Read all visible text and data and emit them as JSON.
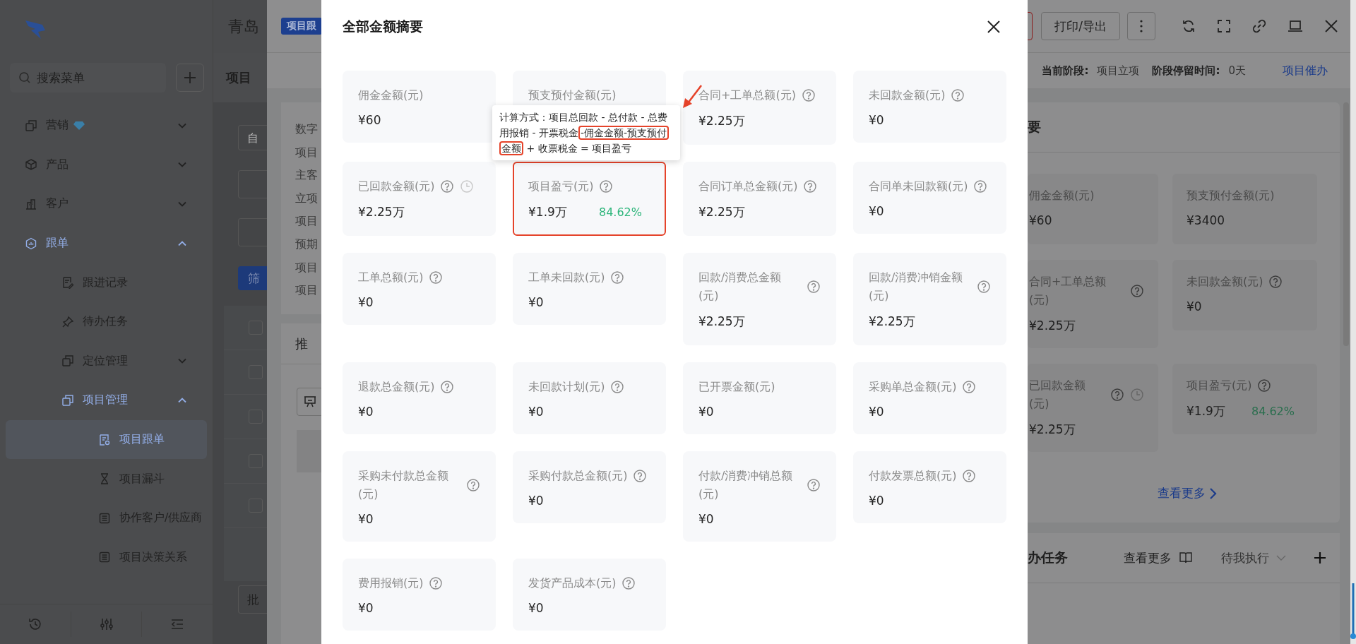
{
  "sidebar": {
    "search_placeholder": "搜索菜单",
    "items": [
      {
        "label": "营销",
        "premium": true,
        "expanded": false,
        "selected": false
      },
      {
        "label": "产品",
        "premium": false,
        "expanded": false,
        "selected": false
      },
      {
        "label": "客户",
        "premium": false,
        "expanded": false,
        "selected": false
      },
      {
        "label": "跟单",
        "premium": false,
        "expanded": true,
        "selected": false,
        "children": [
          {
            "label": "跟进记录",
            "selected": false
          },
          {
            "label": "待办任务",
            "selected": false
          },
          {
            "label": "定位管理",
            "expanded": false,
            "selected": false
          },
          {
            "label": "项目管理",
            "expanded": true,
            "selected": false,
            "children": [
              {
                "label": "项目跟单",
                "selected": true
              },
              {
                "label": "项目漏斗",
                "selected": false
              },
              {
                "label": "协作客户/供应商",
                "selected": false
              },
              {
                "label": "项目决策关系",
                "selected": false
              }
            ]
          }
        ]
      }
    ]
  },
  "left_page": {
    "app_title": "青岛",
    "title": "项目",
    "search_placeholder": "自",
    "filter_button": "筛",
    "batch_button": "批",
    "rows": [
      {
        "checked": false
      },
      {
        "checked": false
      },
      {
        "checked": false
      },
      {
        "checked": false
      },
      {
        "checked": false
      }
    ]
  },
  "drawer": {
    "badge": "项目跟",
    "print_button": "打印/导出",
    "stage_label": "当前阶段:",
    "stage": "项目立项",
    "dwell_label": "阶段停留时间:",
    "dwell": "0天",
    "urge_link": "项目催办",
    "info_labels": [
      "数字",
      "项目",
      "主客",
      "立项",
      "项目",
      "预期",
      "项目",
      "项目"
    ],
    "progress_title": "推",
    "summary": {
      "title": "要",
      "more_link": "查看更多",
      "cards": [
        {
          "label": "佣金金额(元)",
          "value": "¥60",
          "help": false,
          "history": false
        },
        {
          "label": "预支预付金额(元)",
          "value": "¥3400",
          "help": false,
          "history": false
        },
        {
          "label": "合同+工单总额(元)",
          "value": "¥2.25万",
          "help": true,
          "history": false
        },
        {
          "label": "未回款金额(元)",
          "value": "¥0",
          "help": true,
          "history": false
        },
        {
          "label": "已回款金额(元)",
          "value": "¥2.25万",
          "help": true,
          "history": true
        },
        {
          "label": "项目盈亏(元)",
          "value": "¥1.9万",
          "percent": "84.62%",
          "help": true,
          "history": false
        }
      ]
    },
    "tasks": {
      "title": "办任务",
      "more_link": "查看更多",
      "filter": "待我执行"
    }
  },
  "modal": {
    "title": "全部金额摘要",
    "cards": [
      {
        "label": "佣金金额(元)",
        "value": "¥60",
        "help": false,
        "history": false,
        "highlighted": false
      },
      {
        "label": "预支预付金额(元)",
        "help": false,
        "history": false,
        "highlighted": false
      },
      {
        "label": "合同+工单总额(元)",
        "value": "¥2.25万",
        "help": true,
        "history": false,
        "highlighted": false
      },
      {
        "label": "未回款金额(元)",
        "value": "¥0",
        "help": true,
        "history": false,
        "highlighted": false
      },
      {
        "label": "已回款金额(元)",
        "value": "¥2.25万",
        "help": true,
        "history": true,
        "highlighted": false
      },
      {
        "label": "项目盈亏(元)",
        "value": "¥1.9万",
        "percent": "84.62%",
        "help": true,
        "history": false,
        "highlighted": true,
        "tooltip": [
          {
            "text": "计算方式：项目总回款 - 总付款 - 总费用报销 - 开票税金",
            "highlighted": false
          },
          {
            "text": "-佣金金额-预支预付金额",
            "highlighted": true
          },
          {
            "text": " + 收票税金 = 项目盈亏",
            "highlighted": false
          }
        ]
      },
      {
        "label": "合同订单总金额(元)",
        "value": "¥2.25万",
        "help": true,
        "history": false,
        "highlighted": false
      },
      {
        "label": "合同单未回款额(元)",
        "value": "¥0",
        "help": true,
        "history": false,
        "highlighted": false
      },
      {
        "label": "工单总额(元)",
        "value": "¥0",
        "help": true,
        "history": false,
        "highlighted": false
      },
      {
        "label": "工单未回款(元)",
        "value": "¥0",
        "help": true,
        "history": false,
        "highlighted": false
      },
      {
        "label": "回款/消费总金额(元)",
        "value": "¥2.25万",
        "help": true,
        "history": false,
        "highlighted": false
      },
      {
        "label": "回款/消费冲销金额(元)",
        "value": "¥2.25万",
        "help": true,
        "history": false,
        "highlighted": false
      },
      {
        "label": "退款总金额(元)",
        "value": "¥0",
        "help": true,
        "history": false,
        "highlighted": false
      },
      {
        "label": "未回款计划(元)",
        "value": "¥0",
        "help": true,
        "history": false,
        "highlighted": false
      },
      {
        "label": "已开票金额(元)",
        "value": "¥0",
        "help": false,
        "history": false,
        "highlighted": false
      },
      {
        "label": "采购单总金额(元)",
        "value": "¥0",
        "help": true,
        "history": false,
        "highlighted": false
      },
      {
        "label": "采购未付款总金额(元)",
        "value": "¥0",
        "help": true,
        "history": false,
        "highlighted": false
      },
      {
        "label": "采购付款总金额(元)",
        "value": "¥0",
        "help": true,
        "history": false,
        "highlighted": false
      },
      {
        "label": "付款/消费冲销总额(元)",
        "value": "¥0",
        "help": true,
        "history": false,
        "highlighted": false
      },
      {
        "label": "付款发票总额(元)",
        "value": "¥0",
        "help": true,
        "history": false,
        "highlighted": false
      },
      {
        "label": "费用报销(元)",
        "value": "¥0",
        "help": true,
        "history": false,
        "highlighted": false
      },
      {
        "label": "发货产品成本(元)",
        "value": "¥0",
        "help": true,
        "history": false,
        "highlighted": false
      }
    ]
  }
}
